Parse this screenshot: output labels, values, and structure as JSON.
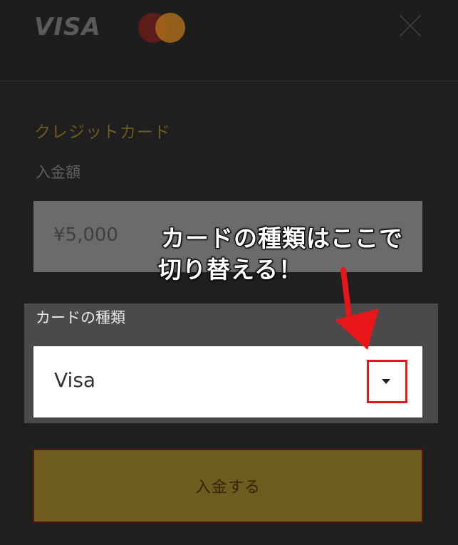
{
  "header": {
    "visa_logo_text": "VISA",
    "mastercard_logo": "mastercard-logo",
    "close_icon": "close-icon"
  },
  "form": {
    "section_title": "クレジットカード",
    "amount_label": "入金額",
    "amount_value": "¥5,000",
    "card_type_label": "カードの種類",
    "card_type_selected": "Visa",
    "submit_label": "入金する"
  },
  "annotation": {
    "line1": "カードの種類はここで",
    "line2": "切り替える！",
    "arrow_color": "#e8161b",
    "box_color": "#e8161b"
  },
  "colors": {
    "background": "#1f1f1f",
    "accent_gold": "#6e5b1e",
    "highlight_red": "#e8161b"
  }
}
